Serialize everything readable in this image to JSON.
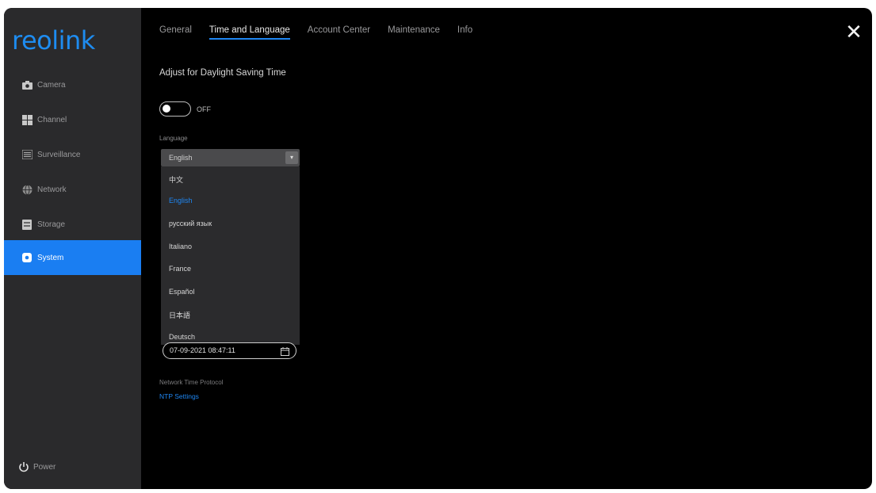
{
  "app": {
    "logo": "reolink",
    "close_symbol": "✕"
  },
  "sidebar": {
    "items": [
      {
        "label": "Camera",
        "icon": "camera-icon"
      },
      {
        "label": "Channel",
        "icon": "channel-grid-icon"
      },
      {
        "label": "Surveillance",
        "icon": "list-icon"
      },
      {
        "label": "Network",
        "icon": "globe-icon"
      },
      {
        "label": "Storage",
        "icon": "storage-icon"
      },
      {
        "label": "System",
        "icon": "gear-icon",
        "active": true
      }
    ],
    "power_label": "Power"
  },
  "tabs": [
    {
      "label": "General"
    },
    {
      "label": "Time and Language",
      "active": true
    },
    {
      "label": "Account Center"
    },
    {
      "label": "Maintenance"
    },
    {
      "label": "Info"
    }
  ],
  "content": {
    "dst_title": "Adjust for Daylight Saving Time",
    "dst_toggle_label": "OFF",
    "language_label": "Language",
    "language_selected": "English",
    "language_options": [
      "中文",
      "English",
      "русский язык",
      "Italiano",
      "France",
      "Español",
      "日本語",
      "Deutsch"
    ],
    "datetime_value": "07-09-2021 08:47:11",
    "ntp_label": "Network Time Protocol",
    "ntp_link": "NTP Settings"
  },
  "colors": {
    "accent": "#1e86f2",
    "sidebar_bg": "#2a2a2c",
    "window_bg": "#000000"
  }
}
